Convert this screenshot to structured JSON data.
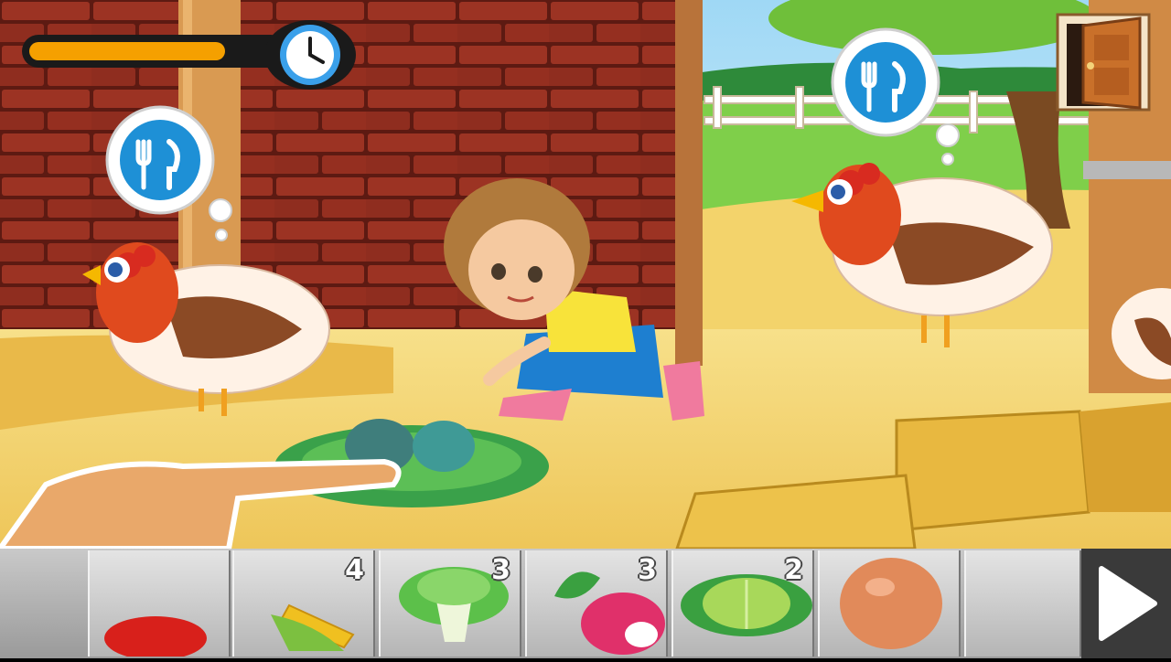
{
  "game": {
    "timer": {
      "progress": 0.78,
      "icon": "clock-icon"
    },
    "hud": {
      "exit_icon": "door-icon",
      "next_icon": "play-arrow-icon"
    },
    "hungry_bubbles": [
      {
        "icon": "fork-knife-icon"
      },
      {
        "icon": "fork-knife-icon"
      }
    ],
    "inventory": [
      {
        "item": "apple",
        "count": ""
      },
      {
        "item": "corn",
        "count": "4"
      },
      {
        "item": "lettuce",
        "count": "3"
      },
      {
        "item": "radish",
        "count": "3"
      },
      {
        "item": "cabbage",
        "count": "2"
      },
      {
        "item": "egg",
        "count": ""
      },
      {
        "item": "empty",
        "count": ""
      }
    ],
    "colors": {
      "timer_fill": "#f5a000",
      "bubble_blue": "#1e90d6",
      "barn_wall": "#8b2a1c",
      "floor": "#f2d36a"
    }
  }
}
